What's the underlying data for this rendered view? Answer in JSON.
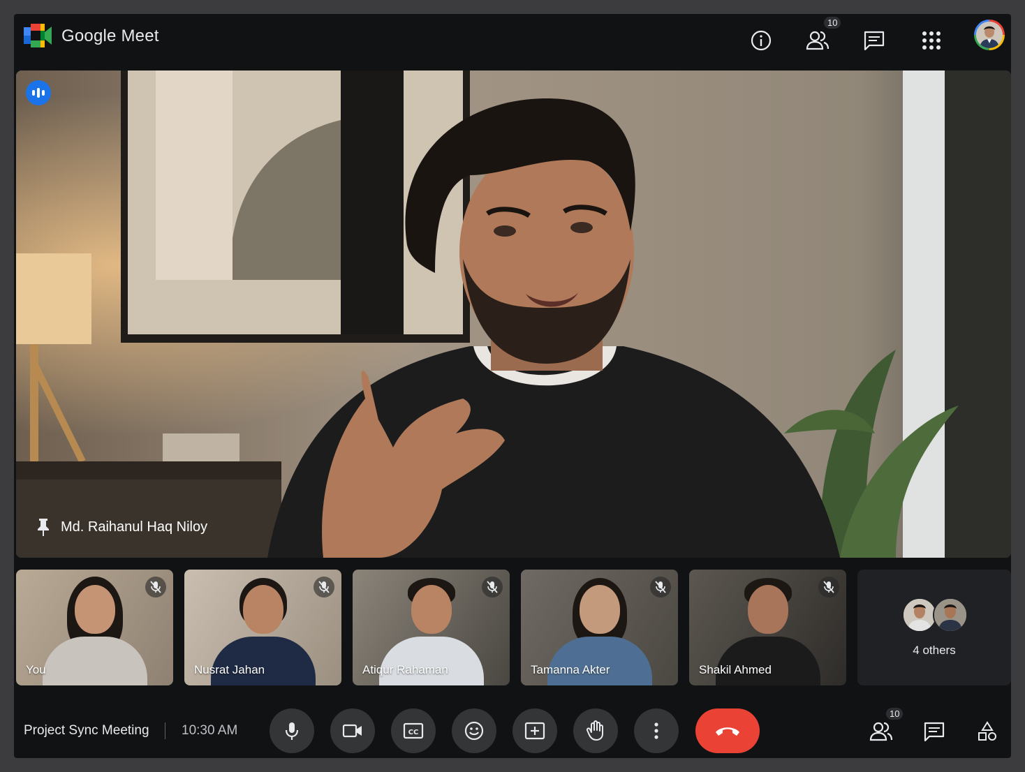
{
  "header": {
    "brand": "Google Meet",
    "participants_badge": "10"
  },
  "main_video": {
    "speaker_name": "Md. Raihanul Haq Niloy"
  },
  "tiles": [
    {
      "name": "You"
    },
    {
      "name": "Nusrat Jahan"
    },
    {
      "name": "Atiqur Rahaman"
    },
    {
      "name": "Tamanna Akter"
    },
    {
      "name": "Shakil Ahmed"
    }
  ],
  "others_tile": {
    "label": "4 others"
  },
  "footer": {
    "meeting_name": "Project Sync Meeting",
    "time": "10:30 AM",
    "participants_badge": "10"
  },
  "colors": {
    "accent_blue": "#1a73e8",
    "end_call_red": "#ea4335",
    "control_bg": "#333537"
  }
}
